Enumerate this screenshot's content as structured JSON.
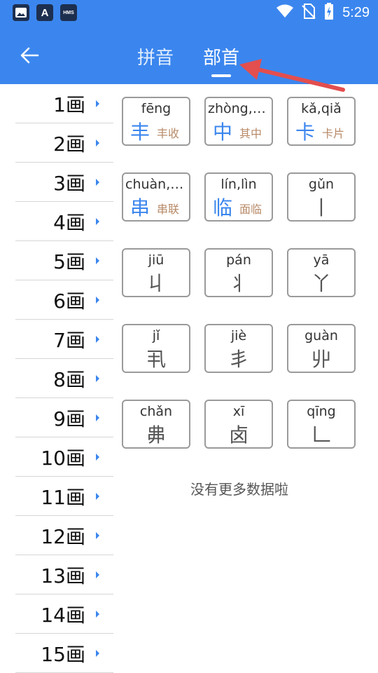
{
  "status_bar": {
    "time": "5:29",
    "app_icons": [
      "image-icon",
      "a-icon",
      "hms-icon"
    ],
    "a_label": "A",
    "hms_label": "HMS"
  },
  "header": {
    "tabs": [
      {
        "label": "拼音",
        "active": false
      },
      {
        "label": "部首",
        "active": true
      }
    ]
  },
  "stroke_list": [
    "1画",
    "2画",
    "3画",
    "4画",
    "5画",
    "6画",
    "7画",
    "8画",
    "9画",
    "10画",
    "11画",
    "12画",
    "13画",
    "14画",
    "15画"
  ],
  "radicals": [
    {
      "pinyin": "fēng",
      "char": "丰",
      "word": "丰收"
    },
    {
      "pinyin": "zhòng,zh…",
      "char": "中",
      "word": "其中"
    },
    {
      "pinyin": "kǎ,qiǎ",
      "char": "卡",
      "word": "卡片"
    },
    {
      "pinyin": "chuàn,g…",
      "char": "串",
      "word": "串联"
    },
    {
      "pinyin": "lín,lìn",
      "char": "临",
      "word": "面临"
    },
    {
      "pinyin": "gǔn",
      "char": "丨",
      "word": ""
    },
    {
      "pinyin": "jiū",
      "char": "丩",
      "word": ""
    },
    {
      "pinyin": "pán",
      "char": "丬",
      "word": ""
    },
    {
      "pinyin": "yā",
      "char": "丫",
      "word": ""
    },
    {
      "pinyin": "jǐ",
      "char": "丮",
      "word": ""
    },
    {
      "pinyin": "jiè",
      "char": "丯",
      "word": ""
    },
    {
      "pinyin": "guàn",
      "char": "丱",
      "word": ""
    },
    {
      "pinyin": "chǎn",
      "char": "丳",
      "word": ""
    },
    {
      "pinyin": "xī",
      "char": "卤",
      "word": ""
    },
    {
      "pinyin": "qīng",
      "char": "𠃊",
      "word": ""
    }
  ],
  "footer": {
    "no_more_text": "没有更多数据啦"
  },
  "colors": {
    "header_bg": "#3b86ee",
    "accent": "#3b86ee",
    "example_word": "#b88a68",
    "annotation_arrow": "#e34e4e"
  }
}
